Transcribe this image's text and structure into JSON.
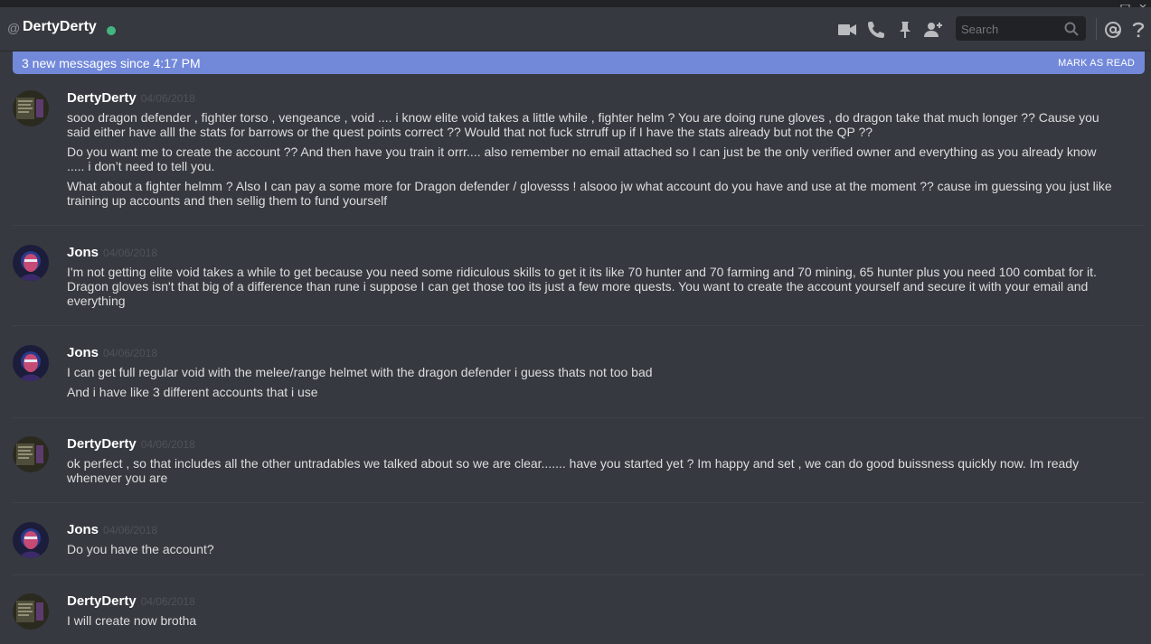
{
  "header": {
    "at_symbol": "@",
    "username": "DertyDerty",
    "status_color": "#43b581",
    "search_placeholder": "Search",
    "icons": [
      "video-call-icon",
      "voice-call-icon",
      "pin-icon",
      "add-friend-icon",
      "search-icon",
      "mention-icon",
      "help-icon"
    ]
  },
  "banner": {
    "text": "3 new messages since 4:17 PM",
    "action": "MARK AS READ",
    "color": "#7289da"
  },
  "messages": [
    {
      "author": "DertyDerty",
      "timestamp": "04/06/2018",
      "lines": [
        "sooo dragon defender , fighter torso , vengeance , void .... i know elite void takes a little while , fighter helm ? You are doing rune gloves , do dragon take that much longer ?? Cause you said either have alll the stats for barrows or the quest points correct ?? Would that not fuck strruff up if I have the stats already but not the QP ??",
        "Do you want me to create the account ?? And then have you train it orrr.... also remember no email attached so I can just be the only verified owner and everything as you already know ..... i don’t need to tell you.",
        "What about a fighter helmm ? Also I can pay a some more for Dragon defender / glovesss ! alsooo jw what account do you have and use at the moment ?? cause im guessing you just like training up accounts and then sellig them to fund yourself"
      ]
    },
    {
      "author": "Jons",
      "timestamp": "04/06/2018",
      "lines": [
        "I'm not getting elite void takes a while to get because you need some ridiculous skills to get it its like 70 hunter and 70 farming and 70 mining, 65 hunter plus you need 100 combat for it.  Dragon gloves isn't that big of a difference than rune i suppose I can get those too its just a few more quests. You want to create the account yourself and secure it with your email and everything"
      ]
    },
    {
      "author": "Jons",
      "timestamp": "04/06/2018",
      "lines": [
        "I can get full regular void with the melee/range helmet with the dragon defender i guess thats not too bad",
        "And i have like 3 different accounts that i use"
      ]
    },
    {
      "author": "DertyDerty",
      "timestamp": "04/06/2018",
      "lines": [
        "ok perfect , so that includes all the other untradables we talked about so we are clear....... have you started yet ? Im happy and set , we can do good buissness quickly now. Im ready whenever you are"
      ]
    },
    {
      "author": "Jons",
      "timestamp": "04/06/2018",
      "lines": [
        "Do you have the account?"
      ]
    },
    {
      "author": "DertyDerty",
      "timestamp": "04/06/2018",
      "lines": [
        "I will create now brotha"
      ]
    }
  ]
}
